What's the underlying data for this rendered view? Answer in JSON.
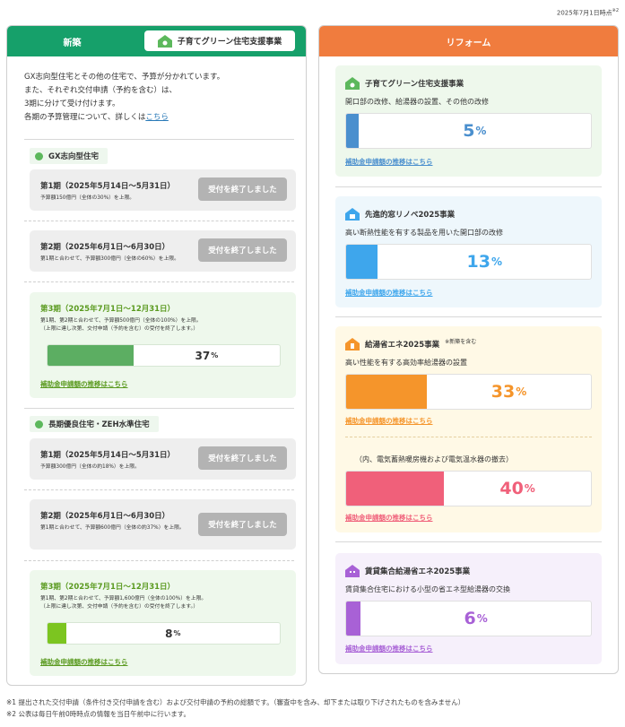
{
  "as_of": "2025年7月1日時点",
  "as_of_mark": "※2",
  "left": {
    "title": "新築",
    "badge": "子育てグリーン住宅支援事業",
    "intro_lines": [
      "GX志向型住宅とその他の住宅で、予算が分かれています。",
      "また、それぞれ交付申請（予約を含む）は、",
      "3期に分けて受け付けます。"
    ],
    "intro_last_prefix": "各期の予算管理について、詳しくは",
    "intro_link": "こちら",
    "gx": {
      "label": "GX志向型住宅",
      "p1_title": "第1期（2025年5月14日～5月31日）",
      "p1_note": "予算額150億円（全体の30%）を上限。",
      "p1_btn": "受付を終了しました",
      "p2_title": "第2期（2025年6月1日～6月30日）",
      "p2_note": "第1期と合わせて、予算額300億円（全体の60%）を上限。",
      "p2_btn": "受付を終了しました",
      "p3_title": "第3期（2025年7月1日～12月31日）",
      "p3_note1": "第1期、第2期と合わせて、予算額500億円（全体の100%）を上限。",
      "p3_note2": "（上限に達し次第、交付申請（予約を含む）の受付を終了します。）",
      "p3_pct": "37",
      "p3_value": 37,
      "p3_link": "補助金申請額の推移はこちら"
    },
    "zeh": {
      "label": "長期優良住宅・ZEH水準住宅",
      "p1_title": "第1期（2025年5月14日～5月31日）",
      "p1_note": "予算額300億円（全体の約18%）を上限。",
      "p1_btn": "受付を終了しました",
      "p2_title": "第2期（2025年6月1日～6月30日）",
      "p2_note": "第1期と合わせて、予算額600億円（全体の約37%）を上限。",
      "p2_btn": "受付を終了しました",
      "p3_title": "第3期（2025年7月1日～12月31日）",
      "p3_note1": "第1期、第2期と合わせて、予算額1,600億円（全体の100%）を上限。",
      "p3_note2": "（上限に達し次第、交付申請（予約を含む）の受付を終了します。）",
      "p3_pct": "8",
      "p3_value": 8,
      "p3_link": "補助金申請額の推移はこちら"
    },
    "pct_unit": "%"
  },
  "right": {
    "title": "リフォーム",
    "b1": {
      "title": "子育てグリーン住宅支援事業",
      "desc": "開口部の改修、給湯器の設置、その他の改修",
      "pct": "5",
      "value": 5,
      "link": "補助金申請額の推移はこちら"
    },
    "b2": {
      "title": "先進的窓リノベ2025事業",
      "desc": "高い断熱性能を有する製品を用いた開口部の改修",
      "pct": "13",
      "value": 13,
      "link": "補助金申請額の推移はこちら"
    },
    "b3": {
      "title": "給湯省エネ2025事業",
      "note": "※新築を含む",
      "desc": "高い性能を有する高効率給湯器の設置",
      "pct": "33",
      "value": 33,
      "link": "補助金申請額の推移はこちら",
      "sub_desc": "（内、電気蓄熱暖房機および電気温水器の撤去）",
      "sub_pct": "40",
      "sub_value": 40,
      "sub_link": "補助金申請額の推移はこちら"
    },
    "b4": {
      "title": "賃貸集合給湯省エネ2025事業",
      "desc": "賃貸集合住宅における小型の省エネ型給湯器の交換",
      "pct": "6",
      "value": 6,
      "link": "補助金申請額の推移はこちら"
    },
    "pct_unit": "%"
  },
  "colors": {
    "green": "#16a06a",
    "orange": "#f07c3e",
    "gx_bar": "#5cae62",
    "zeh_bar": "#7cc520",
    "blue1": "#4a8fce",
    "blue2": "#3ea6ec",
    "orange_bar": "#f5952b",
    "pink_bar": "#f0607a",
    "purple_bar": "#a861d6"
  },
  "footnotes": [
    "※1  提出された交付申請（条件付き交付申請を含む）および交付申請の予約の総額です。（審査中を含み、却下または取り下げされたものを含みません）",
    "※2  公表は毎日午前0時時点の情報を当日午前中に行います。"
  ]
}
